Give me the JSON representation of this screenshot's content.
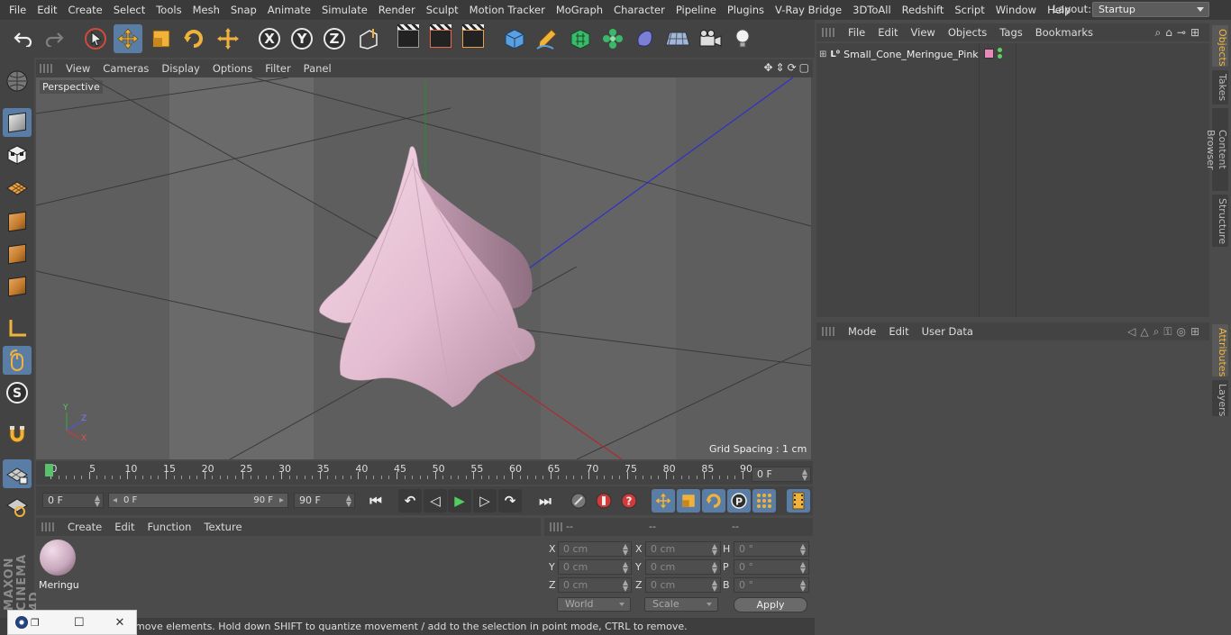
{
  "menubar": {
    "items": [
      "File",
      "Edit",
      "Create",
      "Select",
      "Tools",
      "Mesh",
      "Snap",
      "Animate",
      "Simulate",
      "Render",
      "Sculpt",
      "Motion Tracker",
      "MoGraph",
      "Character",
      "Pipeline",
      "Plugins",
      "V-Ray Bridge",
      "3DToAll",
      "Redshift",
      "Script",
      "Window",
      "Help"
    ],
    "layout_label": "Layout:",
    "layout_value": "Startup"
  },
  "toolbar": {
    "axis_x": "X",
    "axis_y": "Y",
    "axis_z": "Z"
  },
  "viewport": {
    "menu": [
      "View",
      "Cameras",
      "Display",
      "Options",
      "Filter",
      "Panel"
    ],
    "camera_label": "Perspective",
    "grid_spacing": "Grid Spacing : 1 cm",
    "axis_gizmo": {
      "y": "Y",
      "z": "Z",
      "x": "X"
    }
  },
  "timeline": {
    "ticks": [
      0,
      5,
      10,
      15,
      20,
      25,
      30,
      35,
      40,
      45,
      50,
      55,
      60,
      65,
      70,
      75,
      80,
      85,
      90
    ],
    "current_frame": "0 F"
  },
  "transport": {
    "start_field": "0 F",
    "range_start": "0 F",
    "range_end": "90 F",
    "end_field": "90 F"
  },
  "material_manager": {
    "menu": [
      "Create",
      "Edit",
      "Function",
      "Texture"
    ],
    "materials": [
      {
        "name": "Meringu"
      }
    ]
  },
  "coordinates": {
    "head": [
      "--",
      "--",
      "--"
    ],
    "rows": [
      {
        "pos_label": "X",
        "pos": "0 cm",
        "size_label": "X",
        "size": "0 cm",
        "rot_label": "H",
        "rot": "0 °"
      },
      {
        "pos_label": "Y",
        "pos": "0 cm",
        "size_label": "Y",
        "size": "0 cm",
        "rot_label": "P",
        "rot": "0 °"
      },
      {
        "pos_label": "Z",
        "pos": "0 cm",
        "size_label": "Z",
        "size": "0 cm",
        "rot_label": "B",
        "rot": "0 °"
      }
    ],
    "mode_dropdown": "World",
    "scale_dropdown": "Scale",
    "apply_label": "Apply"
  },
  "status_bar": {
    "text": "move elements. Hold down SHIFT to quantize movement / add to the selection in point mode, CTRL to remove."
  },
  "object_manager": {
    "menu": [
      "File",
      "Edit",
      "View",
      "Objects",
      "Tags",
      "Bookmarks"
    ],
    "objects": [
      {
        "name": "Small_Cone_Meringue_Pink",
        "tag_color": "#e88ab9"
      }
    ]
  },
  "attribute_manager": {
    "menu": [
      "Mode",
      "Edit",
      "User Data"
    ]
  },
  "side_tabs": {
    "top": [
      "Objects",
      "Takes",
      "Content Browser",
      "Structure"
    ],
    "bottom": [
      "Attributes",
      "Layers"
    ]
  },
  "colors": {
    "accent": "#5a7da6",
    "playhead": "#57c26b",
    "meringue": "#e9c3d6",
    "tab_active": "#f3b73a"
  },
  "brand": "MAXON CINEMA 4D"
}
